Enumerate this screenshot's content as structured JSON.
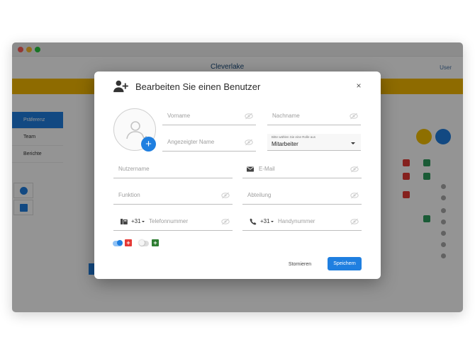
{
  "background_app": {
    "logo": "Cleverlake",
    "user": "User",
    "side_nav": [
      "Präferenz",
      "Team",
      "Berichte"
    ]
  },
  "modal": {
    "title": "Bearbeiten Sie einen Benutzer",
    "close_label": "×",
    "fields": {
      "vorname": {
        "placeholder": "Vorname"
      },
      "nachname": {
        "placeholder": "Nachname"
      },
      "angezeigter_name": {
        "placeholder": "Angezeigter Name"
      },
      "role": {
        "label": "Bitte wählen Sie eine Rolle aus",
        "value": "Mitarbeiter"
      },
      "nutzername": {
        "placeholder": "Nutzername"
      },
      "email": {
        "placeholder": "E-Mail"
      },
      "funktion": {
        "placeholder": "Funktion"
      },
      "abteilung": {
        "placeholder": "Abteilung"
      },
      "telefon": {
        "code": "+31",
        "placeholder": "Telefonnummer"
      },
      "handy": {
        "code": "+31",
        "placeholder": "Handynummer"
      }
    },
    "toggles": [
      {
        "state": "on",
        "badge": "+",
        "badge_color": "#e53935"
      },
      {
        "state": "off",
        "badge": "+",
        "badge_color": "#2e7d32"
      }
    ],
    "buttons": {
      "cancel": "Stornieren",
      "save": "Speichern"
    },
    "colors": {
      "accent": "#1f7fe0",
      "band": "#f5b800"
    }
  }
}
